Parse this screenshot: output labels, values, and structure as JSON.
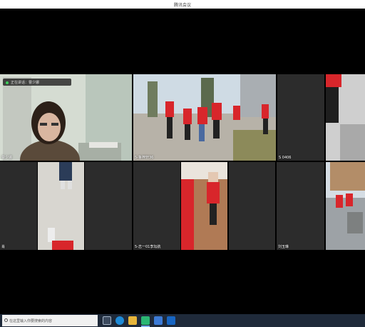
{
  "window": {
    "title": "腾讯会议"
  },
  "status": {
    "text": "正在讲话：曹少娜"
  },
  "participants": [
    {
      "name": "曹少娜"
    },
    {
      "name": "5-鲁梓轩36"
    },
    {
      "name": "S 0406"
    },
    {
      "name": ""
    },
    {
      "name": "肖"
    },
    {
      "name": "5-志一01李坛航"
    },
    {
      "name": "刘玉琳"
    },
    {
      "name": ""
    }
  ],
  "taskbar": {
    "search_placeholder": "在这里输入你要搜索的内容",
    "icons": [
      "start-icon",
      "task-view-icon",
      "edge-icon",
      "explorer-icon",
      "meeting-icon",
      "store-icon",
      "mail-icon"
    ]
  }
}
